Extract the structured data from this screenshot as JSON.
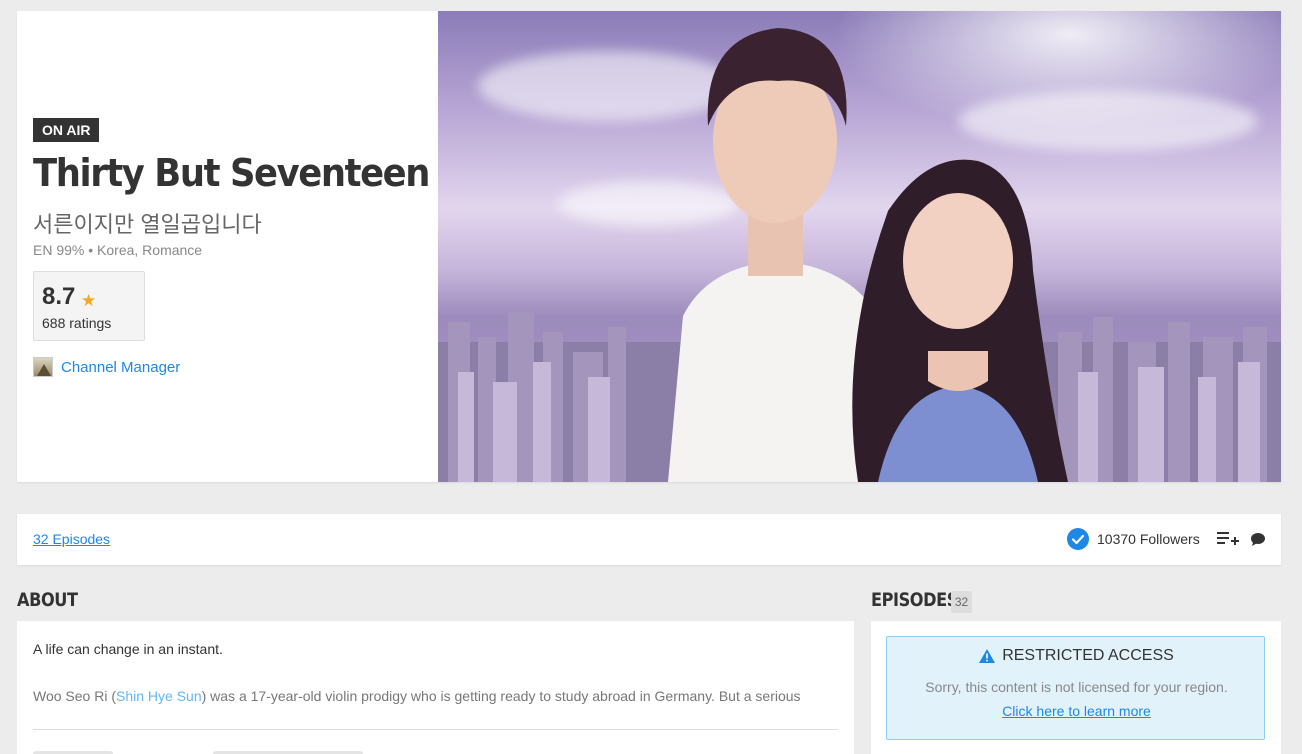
{
  "show": {
    "status_badge": "ON AIR",
    "title": "Thirty But Seventeen",
    "native_title": "서른이지만 열일곱입니다",
    "meta": "EN 99% • Korea, Romance",
    "rating": "8.7",
    "ratings_count": "688 ratings",
    "channel_label": "Channel Manager"
  },
  "bar": {
    "episodes_link": "32 Episodes",
    "followers": "10370 Followers"
  },
  "about": {
    "heading": "ABOUT",
    "tagline": "A life can change in an instant.",
    "desc_prefix": "Woo Seo Ri (",
    "desc_actor": "Shin Hye Sun",
    "desc_suffix": ") was a 17-year-old violin prodigy who is getting ready to study abroad in Germany. But a serious"
  },
  "episodes": {
    "heading": "EPISODES",
    "count": "32",
    "restricted_title": "RESTRICTED ACCESS",
    "restricted_message": "Sorry, this content is not licensed for your region.",
    "restricted_link": "Click here to learn more"
  },
  "colors": {
    "accent": "#1e88e5",
    "star": "#f5a623",
    "badge": "#333333",
    "restricted_bg": "#e1f2fb"
  }
}
